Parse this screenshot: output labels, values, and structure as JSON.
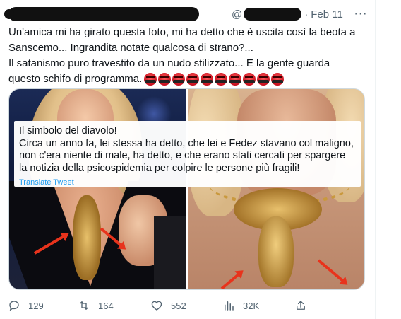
{
  "tweet": {
    "handle_prefix": "@",
    "separator": "·",
    "date": "Feb 11",
    "more_label": "···",
    "text_lines": [
      "Un'amica mi ha girato questa foto, mi ha detto che è uscita così la beota a",
      "Sanscemo... Ingrandita notate qualcosa di strano?...",
      "Il satanismo puro travestito da un nudo stilizzato... E la gente guarda",
      "questo schifo di programma."
    ],
    "emoji_icon": "angry-face-symbols-icon",
    "emoji_count": 10
  },
  "media": {
    "caption_lines": [
      "Il simbolo del diavolo!",
      "Circa un anno fa, lei stessa ha detto, che lei e Fedez stavano col maligno,",
      "non c'era niente di male, ha detto, e che erano stati cercati per spargere",
      "la notizia della psicospidemia per colpire le persone più fragili!"
    ],
    "translate_label": "Translate Tweet",
    "arrow_color": "#e8331c"
  },
  "actions": {
    "replies": "129",
    "retweets": "164",
    "likes": "552",
    "views": "32K"
  },
  "colors": {
    "text": "#0f1419",
    "muted": "#536471",
    "link": "#1d9bf0",
    "border": "#cfd9de"
  }
}
